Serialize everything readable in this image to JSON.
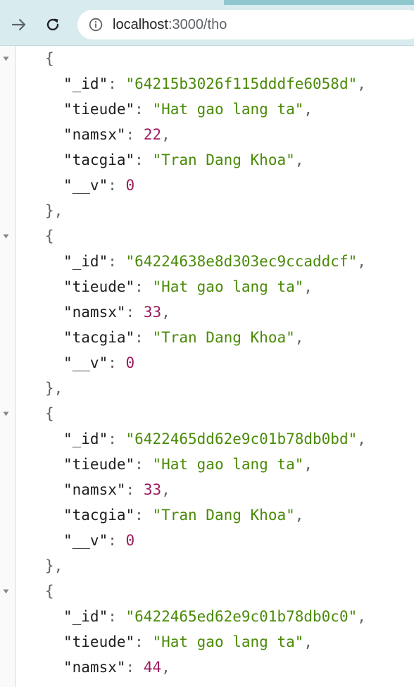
{
  "browser": {
    "address": {
      "host": "localhost",
      "path": ":3000/tho"
    },
    "icons": {
      "forward": "forward-arrow-icon",
      "reload": "reload-icon",
      "site_info": "info-icon",
      "collapse": "collapse-triangle-icon"
    },
    "colors": {
      "toolbar": "#d8ecef",
      "string": "#4a8a07",
      "number": "#9c1b5c"
    }
  },
  "json_viewer": {
    "records": [
      {
        "_id": "64215b3026f115dddfe6058d",
        "tieude": "Hat gao lang ta",
        "namsx": "22",
        "tacgia": "Tran Dang Khoa",
        "__v": "0"
      },
      {
        "_id": "64224638e8d303ec9ccaddcf",
        "tieude": "Hat gao lang ta",
        "namsx": "33",
        "tacgia": "Tran Dang Khoa",
        "__v": "0"
      },
      {
        "_id": "6422465dd62e9c01b78db0bd",
        "tieude": "Hat gao lang ta",
        "namsx": "33",
        "tacgia": "Tran Dang Khoa",
        "__v": "0"
      },
      {
        "_id": "6422465ed62e9c01b78db0c0",
        "tieude": "Hat gao lang ta",
        "namsx": "44"
      }
    ]
  }
}
